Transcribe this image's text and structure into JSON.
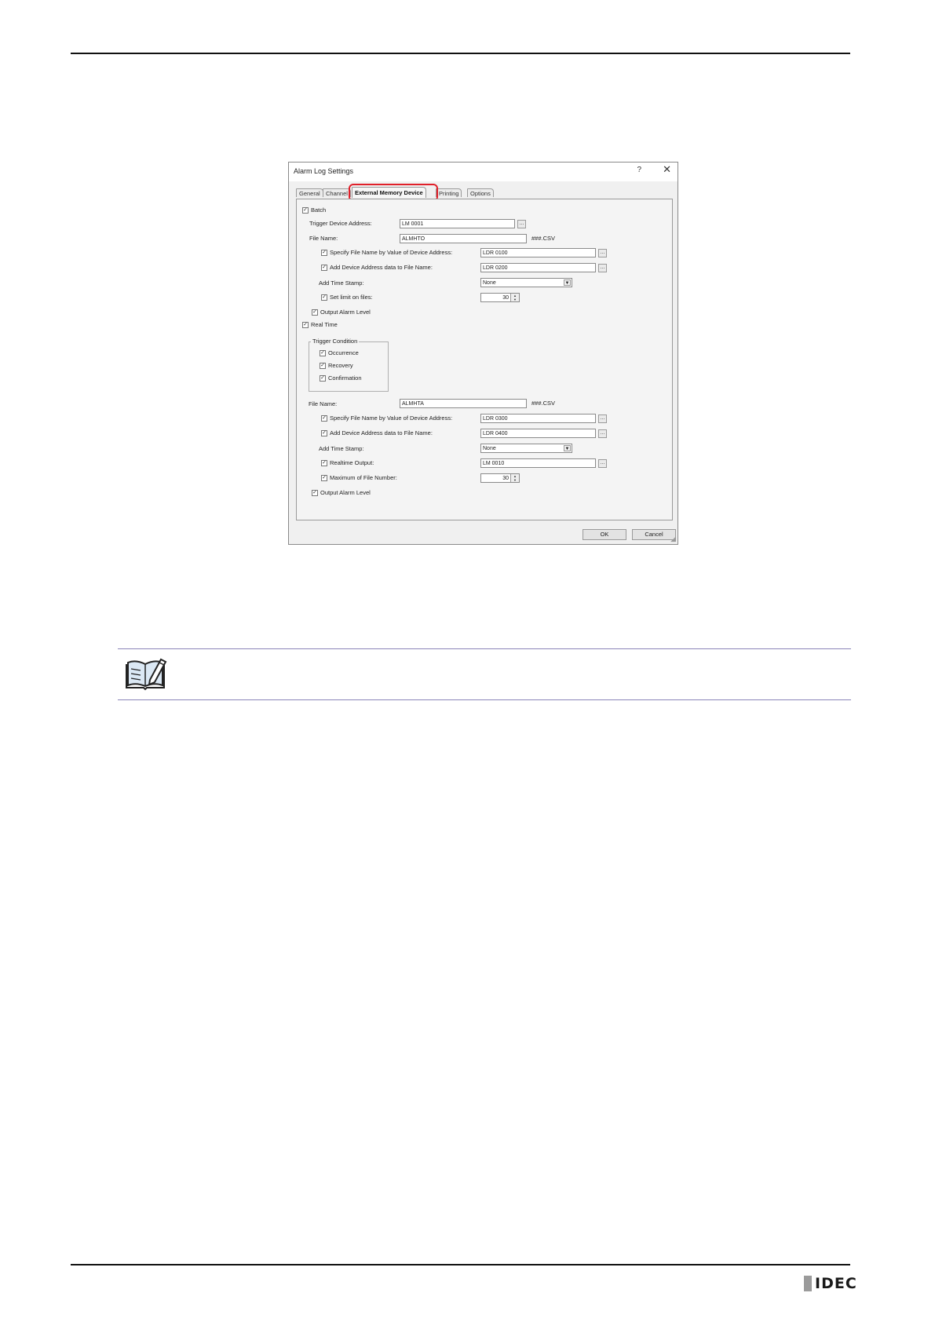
{
  "dialog": {
    "title": "Alarm Log Settings",
    "help": "?",
    "close": "✕",
    "tabs": [
      {
        "label": "General"
      },
      {
        "label": "Channel"
      },
      {
        "label": "External Memory Device"
      },
      {
        "label": "Printing"
      },
      {
        "label": "Options"
      }
    ],
    "highlight_color": "#e0202a",
    "batch": {
      "label": "Batch",
      "checked": true,
      "trigger_label": "Trigger Device Address:",
      "trigger_value": "LM 0001",
      "file_name_label": "File Name:",
      "file_name_value": "ALMHTO",
      "file_suffix": "###.CSV",
      "specify_label": "Specify File Name by Value of Device Address:",
      "specify_value": "LDR 0100",
      "add_device_label": "Add Device Address data to File Name:",
      "add_device_value": "LDR 0200",
      "time_stamp_label": "Add Time Stamp:",
      "time_stamp_value": "None",
      "limit_label": "Set limit on files:",
      "limit_value": "30",
      "output_level_label": "Output Alarm Level"
    },
    "realtime": {
      "label": "Real Time",
      "checked": true,
      "trigger_condition_label": "Trigger Condition",
      "occurrence_label": "Occurrence",
      "recovery_label": "Recovery",
      "confirmation_label": "Confirmation",
      "file_name_label": "File Name:",
      "file_name_value": "ALMHTA",
      "file_suffix": "###.CSV",
      "specify_label": "Specify File Name by Value of Device Address:",
      "specify_value": "LDR 0300",
      "add_device_label": "Add Device Address data to File Name:",
      "add_device_value": "LDR 0400",
      "time_stamp_label": "Add Time Stamp:",
      "time_stamp_value": "None",
      "realtime_output_label": "Realtime Output:",
      "realtime_output_value": "LM 0010",
      "max_file_label": "Maximum of File Number:",
      "max_file_value": "30",
      "output_level_label": "Output Alarm Level"
    },
    "ok_label": "OK",
    "cancel_label": "Cancel",
    "browse_label": "..."
  },
  "footer": {
    "logo_text": "IDEC"
  }
}
